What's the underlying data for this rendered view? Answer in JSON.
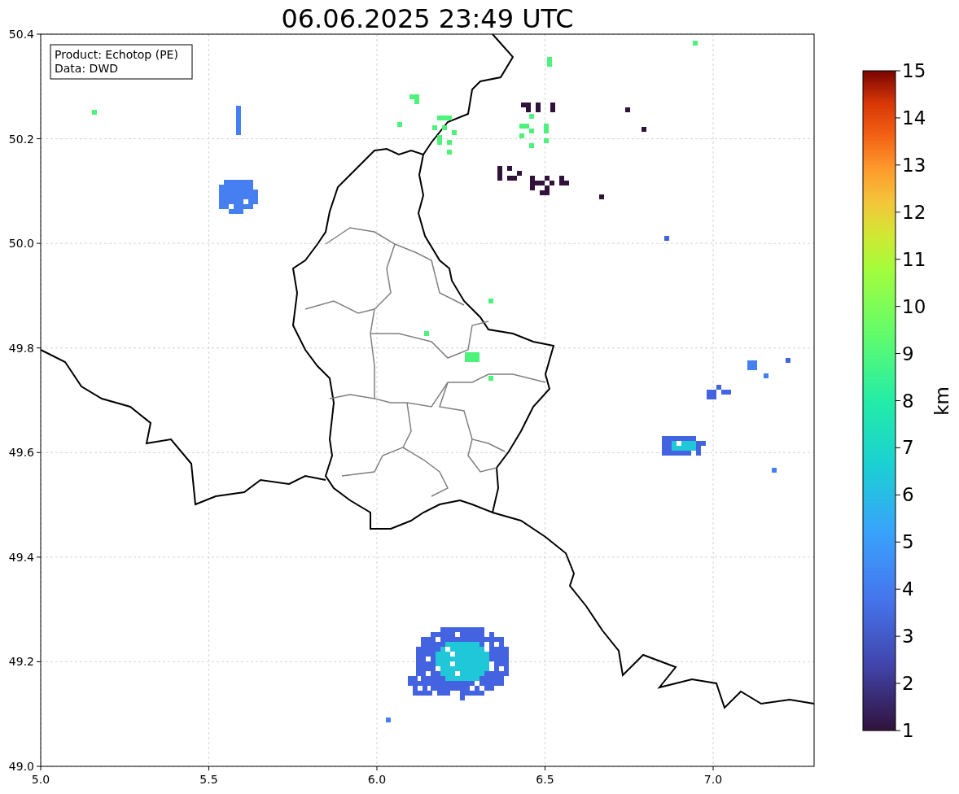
{
  "title": "06.06.2025 23:49 UTC",
  "info_box": [
    "Product: Echotop (PE)",
    "Data: DWD"
  ],
  "x_ticks": [
    "5.0",
    "5.5",
    "6.0",
    "6.5",
    "7.0"
  ],
  "y_ticks": [
    "50.4",
    "50.2",
    "50.0",
    "49.8",
    "49.6",
    "49.4",
    "49.2",
    "49.0"
  ],
  "colorbar": {
    "ticks": [
      "15",
      "14",
      "13",
      "12",
      "11",
      "10",
      "9",
      "8",
      "7",
      "6",
      "5",
      "4",
      "3",
      "2",
      "1"
    ],
    "label": "km"
  }
}
